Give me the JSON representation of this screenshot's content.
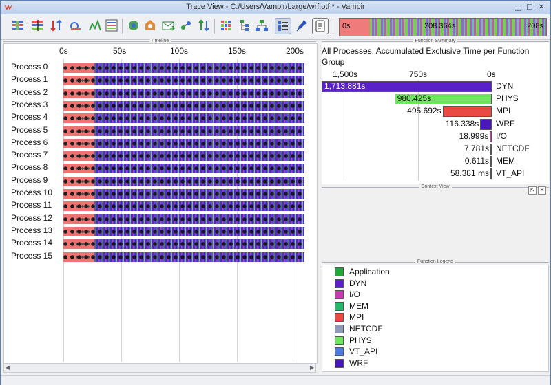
{
  "window": {
    "title": "Trace View - C:/Users/Vampir/Large/wrf.otf * - Vampir",
    "minimize": "▁",
    "maximize": "□",
    "close": "✕",
    "icon": "vampir-logo-icon"
  },
  "toolbar": {
    "buttons": [
      {
        "name": "master-timeline-button",
        "icon": "master-timeline-icon"
      },
      {
        "name": "counter-timeline-button",
        "icon": "counter-timeline-icon"
      },
      {
        "name": "summary-timeline-button",
        "icon": "summary-timeline-icon"
      },
      {
        "name": "process-timeline-button",
        "icon": "process-timeline-icon"
      },
      {
        "name": "performance-radar-button",
        "icon": "performance-radar-icon"
      },
      {
        "name": "function-summary-button",
        "icon": "function-summary-icon"
      },
      {
        "name": "message-summary-button",
        "icon": "message-summary-icon"
      },
      {
        "name": "process-summary-button",
        "icon": "process-summary-icon"
      },
      {
        "name": "communication-matrix-button",
        "icon": "envelope-icon"
      },
      {
        "name": "io-summary-button",
        "icon": "io-icon"
      },
      {
        "name": "call-tree-button",
        "icon": "call-tree-icon"
      },
      {
        "name": "grid-view-button",
        "icon": "grid-icon"
      },
      {
        "name": "tree-button",
        "icon": "tree-icon"
      },
      {
        "name": "hierarchy-button",
        "icon": "hierarchy-icon"
      },
      {
        "name": "legend-button",
        "icon": "legend-list-icon"
      },
      {
        "name": "marker-button",
        "icon": "pin-icon"
      },
      {
        "name": "context-button",
        "icon": "document-icon"
      }
    ]
  },
  "overview": {
    "start": "0s",
    "current": "208.364s",
    "end": "208s"
  },
  "timeline": {
    "caption": "Timeline",
    "ticks": [
      "0s",
      "50s",
      "100s",
      "150s",
      "200s"
    ],
    "processes": [
      "Process 0",
      "Process 1",
      "Process 2",
      "Process 3",
      "Process 4",
      "Process 5",
      "Process 6",
      "Process 7",
      "Process 8",
      "Process 9",
      "Process 10",
      "Process 11",
      "Process 12",
      "Process 13",
      "Process 14",
      "Process 15"
    ]
  },
  "summary": {
    "caption": "Function Summary",
    "title": "All Processes, Accumulated Exclusive Time per Function Group",
    "axis": [
      "1,500s",
      "750s",
      "0s"
    ],
    "rows": [
      {
        "name": "DYN",
        "value": "1,713.881s",
        "seconds": 1713.881,
        "color": "#5b21c8"
      },
      {
        "name": "PHYS",
        "value": "980.425s",
        "seconds": 980.425,
        "color": "#6fe45e"
      },
      {
        "name": "MPI",
        "value": "495.692s",
        "seconds": 495.692,
        "color": "#e94a44"
      },
      {
        "name": "WRF",
        "value": "116.338s",
        "seconds": 116.338,
        "color": "#4a18b8"
      },
      {
        "name": "I/O",
        "value": "18.999s",
        "seconds": 18.999,
        "color": "#c73ab1"
      },
      {
        "name": "NETCDF",
        "value": "7.781s",
        "seconds": 7.781,
        "color": "#8d9ab8"
      },
      {
        "name": "MEM",
        "value": "0.611s",
        "seconds": 0.611,
        "color": "#25b86b"
      },
      {
        "name": "VT_API",
        "value": "58.381 ms",
        "seconds": 0.058381,
        "color": "#4f7ce0"
      }
    ]
  },
  "context": {
    "caption": "Context View"
  },
  "legend": {
    "caption": "Function Legend",
    "items": [
      {
        "name": "Application",
        "color": "#1fa73a"
      },
      {
        "name": "DYN",
        "color": "#5b21c8"
      },
      {
        "name": "I/O",
        "color": "#c73ab1"
      },
      {
        "name": "MEM",
        "color": "#25b86b"
      },
      {
        "name": "MPI",
        "color": "#e94a44"
      },
      {
        "name": "NETCDF",
        "color": "#8d9ab8"
      },
      {
        "name": "PHYS",
        "color": "#6fe45e"
      },
      {
        "name": "VT_API",
        "color": "#4f7ce0"
      },
      {
        "name": "WRF",
        "color": "#4a18b8"
      }
    ]
  }
}
